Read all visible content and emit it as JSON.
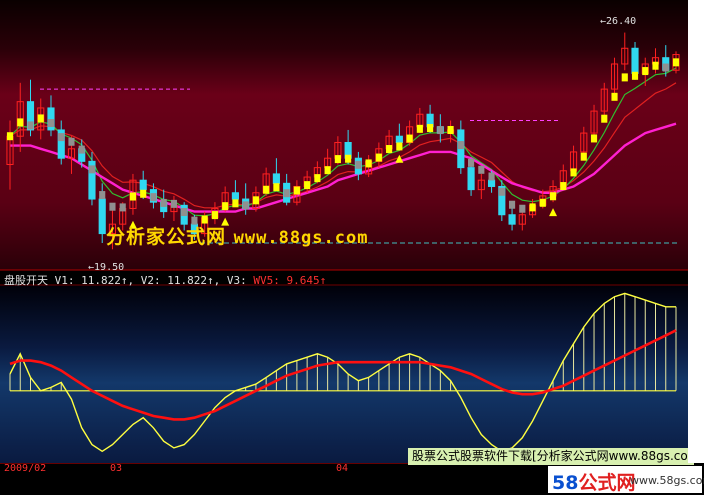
{
  "indicator": {
    "name": "盘股开天",
    "v1": "V1: 11.822↑,",
    "v2": "V2: 11.822↑,",
    "v3": "V3:",
    "v3_name": "WV5:",
    "v3_value": "9.645↑"
  },
  "watermark": {
    "cn": "分析家公式网",
    "url": "www.88gs.com"
  },
  "price_labels": {
    "high": "26.40",
    "low": "19.50"
  },
  "dates": {
    "d1": "2009/02",
    "d2": "03",
    "d3": "04"
  },
  "banner": "股票公式股票软件下载[分析家公式网www.88gs.com]",
  "logo": {
    "num": "58",
    "cn": "公式网",
    "domain": "www.58gs.com"
  },
  "colors": {
    "up": "#ff2020",
    "down": "#30d8f0",
    "neutral": "#909090",
    "ma_magenta": "#ff20d0",
    "step_yellow": "#ffff00",
    "ma_red": "#e02020",
    "ma_green": "#30c030",
    "osc_red": "#ff1010",
    "osc_yellow": "#ffff40"
  },
  "chart_data": [
    {
      "type": "candlestick",
      "candles": [
        [
          22.2,
          23.6,
          21.4,
          23.1
        ],
        [
          23.1,
          24.8,
          22.6,
          24.2
        ],
        [
          24.2,
          24.9,
          23.1,
          23.3
        ],
        [
          23.3,
          24.3,
          23.0,
          24.0
        ],
        [
          24.0,
          24.4,
          23.1,
          23.3
        ],
        [
          23.3,
          23.6,
          22.2,
          22.4
        ],
        [
          22.4,
          23.1,
          21.9,
          22.7
        ],
        [
          22.7,
          23.0,
          22.1,
          22.3
        ],
        [
          22.3,
          22.6,
          20.9,
          21.1
        ],
        [
          21.1,
          21.6,
          19.7,
          20.0
        ],
        [
          20.0,
          20.8,
          19.5,
          20.3
        ],
        [
          20.3,
          21.0,
          20.1,
          20.8
        ],
        [
          20.8,
          21.9,
          20.6,
          21.7
        ],
        [
          21.7,
          22.0,
          21.1,
          21.4
        ],
        [
          21.4,
          21.6,
          20.8,
          21.0
        ],
        [
          21.0,
          21.4,
          20.5,
          20.7
        ],
        [
          20.7,
          21.2,
          20.4,
          20.9
        ],
        [
          20.9,
          21.0,
          20.1,
          20.3
        ],
        [
          20.3,
          20.6,
          19.8,
          20.0
        ],
        [
          20.0,
          20.7,
          19.9,
          20.5
        ],
        [
          20.5,
          21.0,
          20.3,
          20.8
        ],
        [
          20.8,
          21.5,
          20.7,
          21.3
        ],
        [
          21.3,
          21.7,
          20.9,
          21.1
        ],
        [
          21.1,
          21.6,
          20.6,
          20.8
        ],
        [
          20.8,
          21.5,
          20.7,
          21.3
        ],
        [
          21.3,
          22.1,
          21.2,
          21.9
        ],
        [
          21.9,
          22.4,
          21.5,
          21.6
        ],
        [
          21.6,
          21.9,
          20.9,
          21.0
        ],
        [
          21.0,
          21.7,
          20.9,
          21.5
        ],
        [
          21.5,
          22.0,
          21.3,
          21.8
        ],
        [
          21.8,
          22.3,
          21.6,
          22.1
        ],
        [
          22.1,
          22.7,
          21.9,
          22.4
        ],
        [
          22.4,
          23.1,
          22.2,
          22.9
        ],
        [
          22.9,
          23.3,
          22.2,
          22.4
        ],
        [
          22.4,
          22.6,
          21.7,
          21.9
        ],
        [
          21.9,
          22.5,
          21.8,
          22.3
        ],
        [
          22.3,
          22.9,
          22.1,
          22.7
        ],
        [
          22.7,
          23.3,
          22.6,
          23.1
        ],
        [
          23.1,
          23.5,
          22.7,
          22.9
        ],
        [
          22.9,
          23.6,
          22.8,
          23.4
        ],
        [
          23.4,
          24.0,
          23.2,
          23.8
        ],
        [
          23.8,
          24.1,
          23.2,
          23.4
        ],
        [
          23.4,
          23.8,
          22.9,
          23.2
        ],
        [
          23.2,
          23.6,
          22.9,
          23.3
        ],
        [
          23.3,
          23.6,
          21.9,
          22.1
        ],
        [
          22.1,
          22.4,
          21.2,
          21.4
        ],
        [
          21.4,
          21.9,
          21.1,
          21.7
        ],
        [
          21.7,
          22.0,
          21.3,
          21.5
        ],
        [
          21.5,
          21.7,
          20.4,
          20.6
        ],
        [
          20.6,
          20.9,
          20.1,
          20.3
        ],
        [
          20.3,
          20.7,
          20.1,
          20.6
        ],
        [
          20.6,
          21.1,
          20.5,
          20.9
        ],
        [
          20.9,
          21.4,
          20.8,
          21.2
        ],
        [
          21.2,
          21.7,
          21.0,
          21.5
        ],
        [
          21.5,
          22.2,
          21.4,
          22.0
        ],
        [
          22.0,
          22.8,
          21.9,
          22.6
        ],
        [
          22.6,
          23.4,
          22.5,
          23.2
        ],
        [
          23.2,
          24.1,
          23.1,
          23.9
        ],
        [
          23.9,
          24.8,
          23.7,
          24.6
        ],
        [
          24.6,
          25.6,
          24.4,
          25.4
        ],
        [
          25.4,
          26.4,
          25.2,
          25.9
        ],
        [
          25.9,
          26.1,
          24.9,
          25.1
        ],
        [
          25.1,
          25.6,
          24.7,
          25.4
        ],
        [
          25.4,
          25.9,
          25.1,
          25.6
        ],
        [
          25.6,
          26.0,
          25.0,
          25.2
        ],
        [
          25.2,
          25.8,
          25.1,
          25.7
        ]
      ],
      "ma_magenta": [
        22.8,
        22.8,
        22.8,
        22.7,
        22.6,
        22.5,
        22.4,
        22.2,
        22.0,
        21.8,
        21.6,
        21.4,
        21.3,
        21.2,
        21.1,
        21.0,
        20.9,
        20.8,
        20.7,
        20.7,
        20.7,
        20.7,
        20.7,
        20.8,
        20.8,
        20.9,
        21.0,
        21.1,
        21.2,
        21.3,
        21.4,
        21.5,
        21.7,
        21.8,
        21.9,
        22.0,
        22.1,
        22.2,
        22.3,
        22.4,
        22.5,
        22.6,
        22.6,
        22.6,
        22.5,
        22.4,
        22.2,
        22.0,
        21.8,
        21.6,
        21.5,
        21.4,
        21.3,
        21.3,
        21.4,
        21.5,
        21.7,
        21.9,
        22.2,
        22.5,
        22.8,
        23.0,
        23.2,
        23.3,
        23.4,
        23.5
      ],
      "x_labels": [
        "2009/02",
        "03",
        "04"
      ]
    },
    {
      "type": "line",
      "series": [
        {
          "name": "V1",
          "values": [
            50,
            62,
            48,
            40,
            42,
            45,
            35,
            18,
            8,
            4,
            8,
            14,
            20,
            24,
            18,
            10,
            6,
            8,
            14,
            22,
            30,
            36,
            40,
            42,
            44,
            48,
            52,
            56,
            58,
            60,
            62,
            60,
            56,
            50,
            46,
            48,
            52,
            56,
            60,
            62,
            60,
            56,
            52,
            46,
            36,
            24,
            14,
            8,
            4,
            6,
            12,
            22,
            34,
            46,
            58,
            68,
            78,
            86,
            92,
            96,
            98,
            96,
            94,
            92,
            90,
            90
          ]
        },
        {
          "name": "V2",
          "values": [
            50,
            62,
            48,
            40,
            42,
            45,
            35,
            18,
            8,
            4,
            8,
            14,
            20,
            24,
            18,
            10,
            6,
            8,
            14,
            22,
            30,
            36,
            40,
            42,
            44,
            48,
            52,
            56,
            58,
            60,
            62,
            60,
            56,
            50,
            46,
            48,
            52,
            56,
            60,
            62,
            60,
            56,
            52,
            46,
            36,
            24,
            14,
            8,
            4,
            6,
            12,
            22,
            34,
            46,
            58,
            68,
            78,
            86,
            92,
            96,
            98,
            96,
            94,
            92,
            90,
            90
          ]
        },
        {
          "name": "WV5",
          "values": [
            56,
            58,
            58,
            57,
            55,
            52,
            48,
            44,
            40,
            37,
            34,
            31,
            29,
            27,
            25,
            24,
            23,
            23,
            24,
            26,
            28,
            31,
            34,
            37,
            40,
            43,
            46,
            49,
            51,
            53,
            55,
            56,
            57,
            57,
            57,
            57,
            57,
            57,
            57,
            57,
            57,
            56,
            55,
            54,
            52,
            50,
            47,
            44,
            41,
            39,
            38,
            38,
            39,
            41,
            43,
            46,
            49,
            52,
            55,
            58,
            61,
            64,
            67,
            70,
            73,
            76
          ]
        }
      ],
      "baseline": 40,
      "ylim": [
        0,
        100
      ]
    }
  ]
}
